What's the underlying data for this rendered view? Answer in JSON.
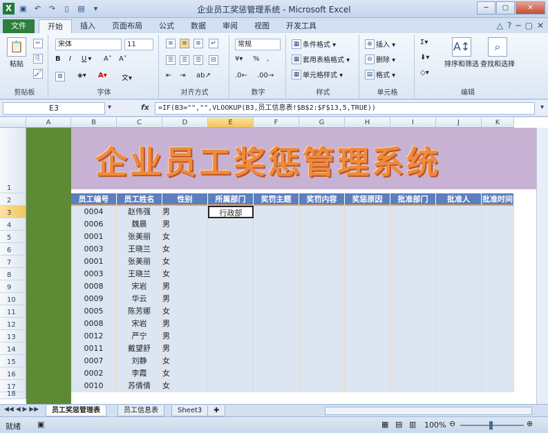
{
  "window": {
    "title": "企业员工奖惩管理系统 - Microsoft Excel",
    "app_icon": "X"
  },
  "tabs": [
    "文件",
    "开始",
    "插入",
    "页面布局",
    "公式",
    "数据",
    "审阅",
    "视图",
    "开发工具"
  ],
  "ribbon": {
    "clipboard": {
      "label": "剪贴板",
      "paste": "粘贴"
    },
    "font": {
      "label": "字体",
      "font_name": "宋体",
      "font_size": "11"
    },
    "alignment": {
      "label": "对齐方式"
    },
    "number": {
      "label": "数字",
      "format": "常规"
    },
    "styles": {
      "label": "样式",
      "items": [
        "条件格式 ▾",
        "套用表格格式 ▾",
        "单元格样式 ▾"
      ]
    },
    "cells": {
      "label": "单元格",
      "items": [
        "插入 ▾",
        "删除 ▾",
        "格式 ▾"
      ]
    },
    "editing": {
      "label": "编辑",
      "sort": "排序和筛选",
      "find": "查找和选择"
    }
  },
  "formula_bar": {
    "name_box": "E3",
    "fx": "fx",
    "formula": "=IF(B3=\"\",\"\",VLOOKUP(B3,员工信息表!$B$2:$F$13,5,TRUE))"
  },
  "columns": [
    "A",
    "B",
    "C",
    "D",
    "E",
    "F",
    "G",
    "H",
    "I",
    "J",
    "K"
  ],
  "rows": [
    "1",
    "2",
    "3",
    "4",
    "5",
    "6",
    "7",
    "8",
    "9",
    "10",
    "11",
    "12",
    "13",
    "14",
    "15",
    "16",
    "17",
    "18"
  ],
  "banner_title": "企业员工奖惩管理系统",
  "table_headers": [
    "员工编号",
    "员工姓名",
    "性别",
    "所属部门",
    "奖罚主题",
    "奖罚内容",
    "奖惩原因",
    "批准部门",
    "批准人",
    "批准时间"
  ],
  "table_rows": [
    [
      "0004",
      "赵伟强",
      "男",
      "行政部"
    ],
    [
      "0006",
      "魏晨",
      "男",
      ""
    ],
    [
      "0001",
      "张美丽",
      "女",
      ""
    ],
    [
      "0003",
      "王晓兰",
      "女",
      ""
    ],
    [
      "0001",
      "张美丽",
      "女",
      ""
    ],
    [
      "0003",
      "王晓兰",
      "女",
      ""
    ],
    [
      "0008",
      "宋岩",
      "男",
      ""
    ],
    [
      "0009",
      "华云",
      "男",
      ""
    ],
    [
      "0005",
      "陈芳娜",
      "女",
      ""
    ],
    [
      "0008",
      "宋岩",
      "男",
      ""
    ],
    [
      "0012",
      "严宁",
      "男",
      ""
    ],
    [
      "0011",
      "戴望舒",
      "男",
      ""
    ],
    [
      "0007",
      "刘静",
      "女",
      ""
    ],
    [
      "0002",
      "李霞",
      "女",
      ""
    ],
    [
      "0010",
      "苏倩倩",
      "女",
      ""
    ]
  ],
  "sheet_tabs": [
    "员工奖惩管理表",
    "员工信息表",
    "Sheet3"
  ],
  "status": {
    "ready": "就绪",
    "zoom": "100%"
  }
}
